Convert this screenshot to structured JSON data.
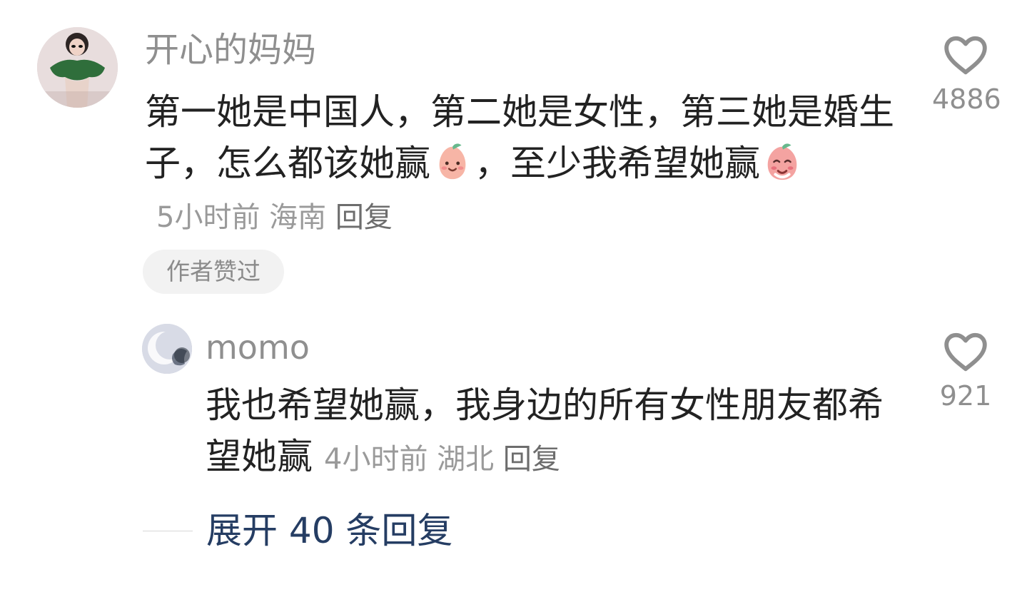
{
  "comments": [
    {
      "username": "开心的妈妈",
      "content_parts": [
        "第一她是中国人，第二她是女性，第三她是婚生子，怎么都该她赢",
        "，至少我希望她赢"
      ],
      "time": "5小时前",
      "location": "海南",
      "reply_label": "回复",
      "badge": "作者赞过",
      "likes": "4886",
      "avatar": "avatar-image-green-dress-woman",
      "emoji_1": "smiling-peach-emoji",
      "emoji_2": "blushing-cute-emoji"
    },
    {
      "username": "momo",
      "content": "我也希望她赢，我身边的所有女性朋友都希望她赢",
      "time": "4小时前",
      "location": "湖北",
      "reply_label": "回复",
      "likes": "921",
      "avatar": "avatar-image-moon"
    }
  ],
  "expand_replies_label": "展开 40 条回复",
  "colors": {
    "username": "#8f8f8f",
    "content": "#222222",
    "meta": "#9a9a9a",
    "link": "#253d63",
    "badge_bg": "#f2f2f2"
  }
}
